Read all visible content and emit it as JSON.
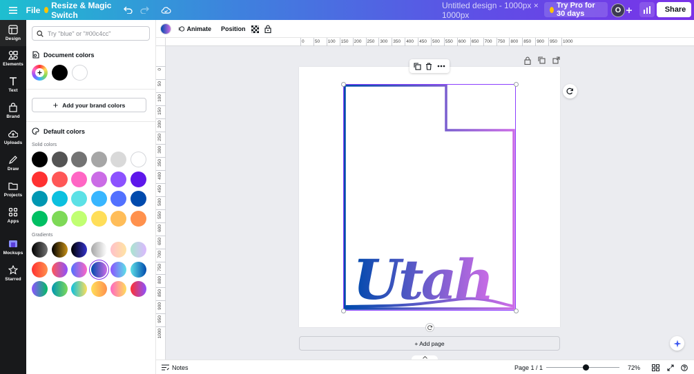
{
  "topbar": {
    "menu_icon": "hamburger-icon",
    "file_label": "File",
    "resize_label": "Resize & Magic Switch",
    "design_title": "Untitled design - 1000px × 1000px",
    "try_pro_label": "Try Pro for 30 days",
    "avatar_initial": "O",
    "share_label": "Share"
  },
  "rail": {
    "items": [
      {
        "label": "Design",
        "icon": "design-icon"
      },
      {
        "label": "Elements",
        "icon": "elements-icon"
      },
      {
        "label": "Text",
        "icon": "text-icon"
      },
      {
        "label": "Brand",
        "icon": "brand-icon"
      },
      {
        "label": "Uploads",
        "icon": "uploads-icon"
      },
      {
        "label": "Draw",
        "icon": "draw-icon"
      },
      {
        "label": "Projects",
        "icon": "projects-icon"
      },
      {
        "label": "Apps",
        "icon": "apps-icon"
      },
      {
        "label": "Mockups",
        "icon": "mockups-icon"
      },
      {
        "label": "Starred",
        "icon": "star-icon"
      }
    ]
  },
  "panel": {
    "search_placeholder": "Try \"blue\" or \"#00c4cc\"",
    "search_value": "",
    "document_colors_title": "Document colors",
    "document_colors": [
      "#000000",
      "#ffffff"
    ],
    "brand_button_label": "Add your brand colors",
    "default_colors_title": "Default colors",
    "solid_colors_label": "Solid colors",
    "solid_colors": [
      [
        "#000000",
        "#545454",
        "#737373",
        "#a6a6a6",
        "#d9d9d9",
        "#ffffff"
      ],
      [
        "#ff3131",
        "#ff5757",
        "#ff66c4",
        "#cb6ce6",
        "#8c52ff",
        "#5e17eb"
      ],
      [
        "#0097b2",
        "#0cc0df",
        "#5ce1e6",
        "#38b6ff",
        "#5271ff",
        "#004aad"
      ],
      [
        "#00bf63",
        "#7ed957",
        "#c1ff72",
        "#ffde59",
        "#ffbd59",
        "#ff914d"
      ]
    ],
    "gradients_label": "Gradients",
    "gradients": [
      [
        [
          "#000000",
          "#737373"
        ],
        [
          "#000000",
          "#c89116"
        ],
        [
          "#000000",
          "#3533cd"
        ],
        [
          "#a6a6a6",
          "#ffffff"
        ],
        [
          "#ffc0cb",
          "#ffe4a3"
        ],
        [
          "#a8e6cf",
          "#dcb8ff"
        ]
      ],
      [
        [
          "#ff3131",
          "#ff914d"
        ],
        [
          "#ff5757",
          "#8c52ff"
        ],
        [
          "#5170ff",
          "#ff66c4"
        ],
        [
          "#004aad",
          "#cb6ce6"
        ],
        [
          "#8c52ff",
          "#5ce1e6"
        ],
        [
          "#5de0e6",
          "#004aad"
        ]
      ],
      [
        [
          "#8c52ff",
          "#00bf63"
        ],
        [
          "#0097b2",
          "#7ed957"
        ],
        [
          "#0cc0df",
          "#ffde59"
        ],
        [
          "#ffde59",
          "#ff914d"
        ],
        [
          "#ff66c4",
          "#ffde59"
        ],
        [
          "#ff3131",
          "#8c52ff"
        ]
      ]
    ],
    "selected_gradient": [
      1,
      3
    ]
  },
  "toolbar": {
    "color_chip": [
      "#004aad",
      "#cb6ce6"
    ],
    "animate_label": "Animate",
    "position_label": "Position"
  },
  "rulers": {
    "h_ticks": [
      "0",
      "50",
      "100",
      "150",
      "200",
      "250",
      "300",
      "350",
      "400",
      "450",
      "500",
      "550",
      "600",
      "650",
      "700",
      "750",
      "800",
      "850",
      "900",
      "950",
      "1000"
    ],
    "v_ticks": [
      "0",
      "50",
      "100",
      "150",
      "200",
      "250",
      "300",
      "350",
      "400",
      "450",
      "500",
      "550",
      "600",
      "650",
      "700",
      "750",
      "800",
      "850",
      "900",
      "950",
      "1000"
    ]
  },
  "canvas": {
    "artwork_text": "Utah",
    "gradient": [
      "#004aad",
      "#cb6ce6"
    ],
    "add_page_label": "+ Add page"
  },
  "bottombar": {
    "notes_label": "Notes",
    "page_indicator": "Page 1 / 1",
    "zoom_value": 72,
    "zoom_label": "72%"
  }
}
